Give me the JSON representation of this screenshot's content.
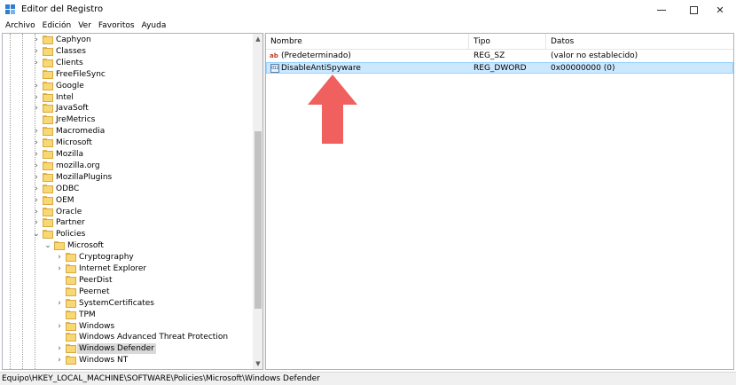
{
  "window": {
    "title": "Editor del Registro"
  },
  "menu": [
    "Archivo",
    "Edición",
    "Ver",
    "Favoritos",
    "Ayuda"
  ],
  "tree": {
    "nodes": [
      {
        "label": "Caphyon",
        "expander": "›"
      },
      {
        "label": "Classes",
        "expander": "›"
      },
      {
        "label": "Clients",
        "expander": "›"
      },
      {
        "label": "FreeFileSync",
        "expander": ""
      },
      {
        "label": "Google",
        "expander": "›"
      },
      {
        "label": "Intel",
        "expander": "›"
      },
      {
        "label": "JavaSoft",
        "expander": "›"
      },
      {
        "label": "JreMetrics",
        "expander": ""
      },
      {
        "label": "Macromedia",
        "expander": "›"
      },
      {
        "label": "Microsoft",
        "expander": "›"
      },
      {
        "label": "Mozilla",
        "expander": "›"
      },
      {
        "label": "mozilla.org",
        "expander": "›"
      },
      {
        "label": "MozillaPlugins",
        "expander": "›"
      },
      {
        "label": "ODBC",
        "expander": "›"
      },
      {
        "label": "OEM",
        "expander": "›"
      },
      {
        "label": "Oracle",
        "expander": "›"
      },
      {
        "label": "Partner",
        "expander": "›"
      },
      {
        "label": "Policies",
        "expander": "⌄"
      },
      {
        "label": "Microsoft",
        "expander": "⌄"
      },
      {
        "label": "Cryptography",
        "expander": "›"
      },
      {
        "label": "Internet Explorer",
        "expander": "›"
      },
      {
        "label": "PeerDist",
        "expander": ""
      },
      {
        "label": "Peernet",
        "expander": ""
      },
      {
        "label": "SystemCertificates",
        "expander": "›"
      },
      {
        "label": "TPM",
        "expander": ""
      },
      {
        "label": "Windows",
        "expander": "›"
      },
      {
        "label": "Windows Advanced Threat Protection",
        "expander": ""
      },
      {
        "label": "Windows Defender",
        "expander": "›"
      },
      {
        "label": "Windows NT",
        "expander": "›"
      }
    ]
  },
  "list": {
    "columns": [
      "Nombre",
      "Tipo",
      "Datos"
    ],
    "rows": [
      {
        "name": "(Predeterminado)",
        "type": "REG_SZ",
        "data": "(valor no establecido)",
        "icon": "string-value-icon"
      },
      {
        "name": "DisableAntiSpyware",
        "type": "REG_DWORD",
        "data": "0x00000000 (0)",
        "icon": "binary-value-icon"
      }
    ]
  },
  "status": {
    "path": "Equipo\\HKEY_LOCAL_MACHINE\\SOFTWARE\\Policies\\Microsoft\\Windows Defender"
  },
  "colors": {
    "selection": "#cce8ff",
    "arrow": "#f0605e",
    "folder": "#f8d775"
  }
}
